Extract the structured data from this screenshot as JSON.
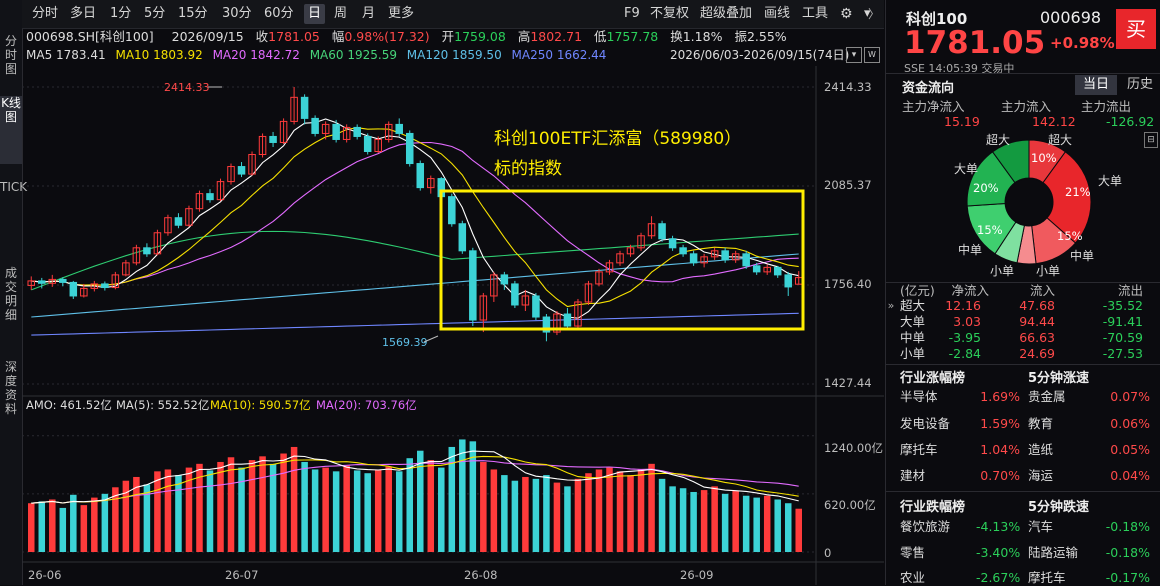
{
  "left_nav": [
    "分时图",
    "K线图",
    "TICK",
    "成交明细",
    "深度资料"
  ],
  "toolbar": {
    "periods": [
      "分时",
      "多日",
      "1分",
      "5分",
      "15分",
      "30分",
      "60分",
      "日",
      "周",
      "月",
      "更多"
    ],
    "active_period": "日",
    "right_items": [
      "F9",
      "不复权",
      "超级叠加",
      "画线",
      "工具"
    ]
  },
  "info": {
    "code": "000698.SH[科创100]",
    "date": "2026/09/15",
    "close_label": "收",
    "close": "1781.05",
    "amp_label": "幅",
    "amp": "0.98%(17.32)",
    "open_label": "开",
    "open": "1759.08",
    "high_label": "高",
    "high": "1802.71",
    "low_label": "低",
    "low": "1757.78",
    "turnover_label": "换",
    "turnover": "1.18%",
    "vib_label": "振",
    "vib": "2.55%"
  },
  "ma_line": {
    "ma5": "MA5 1783.41",
    "ma10": "MA10 1803.92",
    "ma20": "MA20 1842.72",
    "ma60": "MA60 1925.59",
    "ma120": "MA120 1859.50",
    "ma250": "MA250 1662.44",
    "range": "2026/06/03-2026/09/15(74日)"
  },
  "chart_labels": {
    "high_mark": "2414.33",
    "low_mark": "1569.39",
    "annotation_line1": "科创100ETF汇添富（589980）",
    "annotation_line2": "标的指数",
    "price_ticks": [
      "2414.33",
      "2085.37",
      "1756.40",
      "1427.44"
    ],
    "vol_ticks": [
      "1240.00亿",
      "620.00亿",
      "0"
    ],
    "x_ticks": [
      "26-06",
      "26-07",
      "26-08",
      "26-09"
    ]
  },
  "volume_line": {
    "amo": "AMO: 461.52亿",
    "ma5": "MA(5): 552.52亿",
    "ma10": "MA(10): 590.57亿",
    "ma20": "MA(20): 703.76亿"
  },
  "quote": {
    "name": "科创100",
    "code": "000698",
    "buy": "买",
    "price": "1781.05",
    "change": "+0.98%",
    "exchange": "SSE",
    "time": "14:05:39",
    "status": "交易中"
  },
  "fund_flow": {
    "title": "资金流向",
    "tabs": [
      "当日",
      "历史"
    ],
    "headers": [
      "主力净流入",
      "主力流入",
      "主力流出"
    ],
    "values": [
      "15.19",
      "142.12",
      "-126.92"
    ],
    "pie_labels": {
      "super_in": "超大",
      "super_out": "超大",
      "big_in": "大单",
      "big_out": "大单",
      "mid_in": "中单",
      "mid_out": "中单",
      "small_in": "小单",
      "small_out": "小单"
    },
    "pie_pcts": {
      "p10": "10%",
      "p21": "21%",
      "p15r": "15%",
      "p15g": "15%",
      "p20": "20%"
    },
    "table_headers": [
      "(亿元)",
      "净流入",
      "流入",
      "流出"
    ],
    "table_rows": [
      [
        "超大",
        "12.16",
        "47.68",
        "-35.52"
      ],
      [
        "大单",
        "3.03",
        "94.44",
        "-91.41"
      ],
      [
        "中单",
        "-3.95",
        "66.63",
        "-70.59"
      ],
      [
        "小单",
        "-2.84",
        "24.69",
        "-27.53"
      ]
    ]
  },
  "industry_up": {
    "title": "行业涨幅榜",
    "title2": "5分钟涨速",
    "rows": [
      [
        "半导体",
        "1.69%",
        "贵金属",
        "0.07%"
      ],
      [
        "发电设备",
        "1.59%",
        "教育",
        "0.06%"
      ],
      [
        "摩托车",
        "1.04%",
        "造纸",
        "0.05%"
      ],
      [
        "建材",
        "0.70%",
        "海运",
        "0.04%"
      ]
    ]
  },
  "industry_down": {
    "title": "行业跌幅榜",
    "title2": "5分钟跌速",
    "rows": [
      [
        "餐饮旅游",
        "-4.13%",
        "汽车",
        "-0.18%"
      ],
      [
        "零售",
        "-3.40%",
        "陆路运输",
        "-0.18%"
      ],
      [
        "农业",
        "-2.67%",
        "摩托车",
        "-0.17%"
      ]
    ]
  },
  "chart_data": {
    "type": "candlestick",
    "x_ticks": [
      "26-06",
      "26-07",
      "26-08",
      "26-09"
    ],
    "price_ylim": [
      1427.44,
      2414.33
    ],
    "price_ticks": [
      2414.33,
      2085.37,
      1756.4,
      1427.44
    ],
    "high_marker": 2414.33,
    "low_marker": 1569.39,
    "volume_ticks": [
      1240.0,
      620.0,
      0
    ],
    "candles": [
      [
        1755,
        1770,
        1740,
        1785
      ],
      [
        1770,
        1762,
        1745,
        1780
      ],
      [
        1762,
        1775,
        1750,
        1790
      ],
      [
        1775,
        1765,
        1752,
        1782
      ],
      [
        1765,
        1720,
        1710,
        1770
      ],
      [
        1720,
        1745,
        1715,
        1760
      ],
      [
        1745,
        1760,
        1735,
        1770
      ],
      [
        1760,
        1748,
        1738,
        1768
      ],
      [
        1748,
        1790,
        1742,
        1800
      ],
      [
        1790,
        1830,
        1785,
        1840
      ],
      [
        1830,
        1880,
        1822,
        1890
      ],
      [
        1880,
        1860,
        1850,
        1895
      ],
      [
        1860,
        1930,
        1855,
        1940
      ],
      [
        1930,
        1980,
        1920,
        1990
      ],
      [
        1980,
        1955,
        1945,
        1995
      ],
      [
        1955,
        2010,
        1950,
        2020
      ],
      [
        2010,
        2060,
        2000,
        2070
      ],
      [
        2060,
        2040,
        2030,
        2075
      ],
      [
        2040,
        2100,
        2035,
        2110
      ],
      [
        2100,
        2150,
        2090,
        2160
      ],
      [
        2150,
        2125,
        2115,
        2165
      ],
      [
        2125,
        2190,
        2120,
        2200
      ],
      [
        2190,
        2250,
        2180,
        2260
      ],
      [
        2250,
        2230,
        2215,
        2265
      ],
      [
        2230,
        2300,
        2225,
        2310
      ],
      [
        2300,
        2380,
        2290,
        2414.33
      ],
      [
        2380,
        2310,
        2290,
        2390
      ],
      [
        2310,
        2260,
        2250,
        2320
      ],
      [
        2260,
        2290,
        2240,
        2300
      ],
      [
        2290,
        2240,
        2230,
        2305
      ],
      [
        2240,
        2280,
        2230,
        2290
      ],
      [
        2280,
        2250,
        2240,
        2290
      ],
      [
        2250,
        2200,
        2190,
        2260
      ],
      [
        2200,
        2240,
        2195,
        2250
      ],
      [
        2240,
        2290,
        2230,
        2300
      ],
      [
        2290,
        2260,
        2250,
        2310
      ],
      [
        2260,
        2160,
        2150,
        2270
      ],
      [
        2160,
        2080,
        2070,
        2170
      ],
      [
        2080,
        2110,
        2060,
        2120
      ],
      [
        2110,
        2050,
        2040,
        2115
      ],
      [
        2050,
        1960,
        1950,
        2060
      ],
      [
        1960,
        1870,
        1860,
        1970
      ],
      [
        1870,
        1640,
        1620,
        1880
      ],
      [
        1640,
        1720,
        1600,
        1730
      ],
      [
        1720,
        1790,
        1700,
        1800
      ],
      [
        1790,
        1760,
        1740,
        1800
      ],
      [
        1760,
        1690,
        1680,
        1770
      ],
      [
        1690,
        1720,
        1670,
        1740
      ],
      [
        1720,
        1650,
        1640,
        1730
      ],
      [
        1650,
        1600,
        1569.39,
        1660
      ],
      [
        1600,
        1660,
        1590,
        1670
      ],
      [
        1660,
        1620,
        1610,
        1680
      ],
      [
        1620,
        1700,
        1612,
        1710
      ],
      [
        1700,
        1760,
        1690,
        1770
      ],
      [
        1760,
        1800,
        1752,
        1810
      ],
      [
        1800,
        1830,
        1790,
        1840
      ],
      [
        1830,
        1860,
        1820,
        1870
      ],
      [
        1860,
        1880,
        1850,
        1890
      ],
      [
        1880,
        1920,
        1870,
        1930
      ],
      [
        1920,
        1960,
        1910,
        1985
      ],
      [
        1960,
        1910,
        1900,
        1970
      ],
      [
        1910,
        1880,
        1870,
        1920
      ],
      [
        1880,
        1860,
        1850,
        1890
      ],
      [
        1860,
        1830,
        1820,
        1870
      ],
      [
        1830,
        1850,
        1815,
        1860
      ],
      [
        1850,
        1870,
        1840,
        1880
      ],
      [
        1870,
        1840,
        1830,
        1880
      ],
      [
        1840,
        1860,
        1830,
        1870
      ],
      [
        1860,
        1820,
        1810,
        1870
      ],
      [
        1820,
        1800,
        1790,
        1830
      ],
      [
        1800,
        1815,
        1790,
        1825
      ],
      [
        1815,
        1790,
        1780,
        1820
      ],
      [
        1790,
        1750,
        1720,
        1800
      ],
      [
        1759.08,
        1781.05,
        1757.78,
        1802.71
      ]
    ],
    "volumes": [
      520,
      540,
      560,
      470,
      610,
      500,
      580,
      620,
      690,
      760,
      800,
      720,
      860,
      880,
      820,
      900,
      940,
      870,
      960,
      1010,
      900,
      980,
      1020,
      940,
      1050,
      1120,
      960,
      880,
      900,
      860,
      920,
      870,
      840,
      880,
      910,
      860,
      1000,
      1080,
      980,
      900,
      1120,
      1200,
      1180,
      960,
      880,
      820,
      760,
      800,
      780,
      820,
      740,
      700,
      780,
      840,
      880,
      900,
      860,
      820,
      880,
      940,
      780,
      700,
      680,
      640,
      660,
      700,
      620,
      650,
      600,
      580,
      600,
      560,
      520,
      461.52
    ],
    "amo": 461.52,
    "amo_ma5": 552.52,
    "amo_ma10": 590.57,
    "amo_ma20": 703.76,
    "colors": {
      "up": "#ff3b3b",
      "down": "#3cd3d6",
      "ma5": "#ffffff",
      "ma10": "#f5e000",
      "ma20": "#e26bff",
      "ma60": "#2ecc71",
      "ma120": "#5fc0e8",
      "ma250": "#6f86ff",
      "highlight": "#ffee00"
    }
  }
}
